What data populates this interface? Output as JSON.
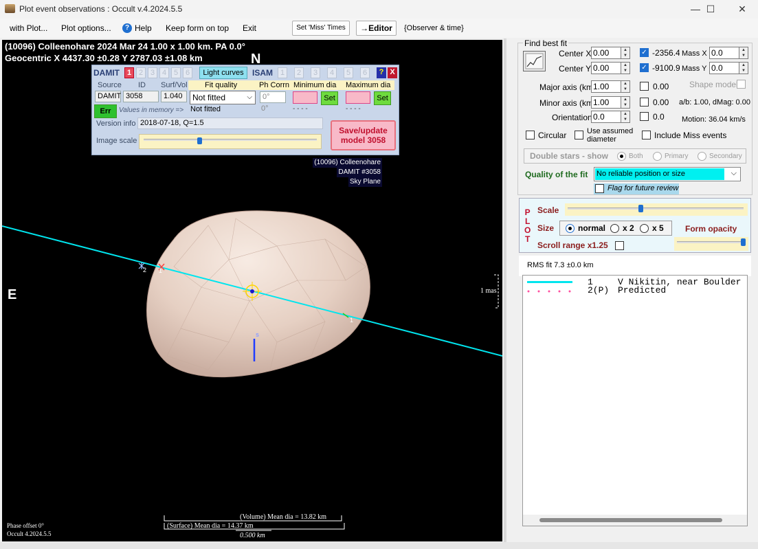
{
  "window": {
    "title": "Plot event observations : Occult v.4.2024.5.5",
    "min": "—",
    "max": "☐",
    "close": "✕"
  },
  "menu": {
    "with_plot": "with Plot...",
    "plot_options": "Plot options...",
    "help": "Help",
    "keep_on_top": "Keep form on top",
    "exit": "Exit",
    "set_miss": "Set 'Miss' Times",
    "editor": "→Editor",
    "observer_time": "{Observer & time}"
  },
  "plot": {
    "header1": "(10096) Colleenohare  2024 Mar 24   1.00 x 1.00 km.  PA 0.0°",
    "header2": "Geocentric  X 4437.30 ±0.28  Y 2787.03 ±1.08 km",
    "north": "N",
    "east": "E",
    "south": "s",
    "chord_labels": [
      "2",
      "1",
      "1"
    ],
    "model_label": [
      "(10096) Colleenohare",
      "DAMIT #3058",
      "Sky Plane"
    ],
    "scale_mas": "1 mas",
    "volume_dia": "(Volume) Mean dia = 13.82 km",
    "surface_dia": "(Surface) Mean dia = 14.37 km",
    "scale_km": "0.500 km",
    "phase_offset": "Phase offset 0°",
    "version": "Occult 4.2024.5.5"
  },
  "damit": {
    "damit_label": "DAMIT",
    "nums": [
      "1",
      "2",
      "3",
      "4",
      "5",
      "6"
    ],
    "light_curves": "Light curves",
    "isam_label": "ISAM",
    "isam_nums": [
      "1",
      "2",
      "3",
      "4",
      "5",
      "6"
    ],
    "help": "?",
    "close": "X",
    "source_h": "Source",
    "id_h": "ID",
    "surfvol_h": "Surf/Vol",
    "fit_quality_h": "Fit quality",
    "ph_corrn_h": "Ph Corrn",
    "min_dia_h": "Minimum dia",
    "max_dia_h": "Maximum dia",
    "source": "DAMIT",
    "id": "3058",
    "surfvol": "1.040",
    "fit_quality": "Not fitted",
    "ph_corrn": "0°",
    "set": "Set",
    "err": "Err",
    "values_in_memory": "Values in memory =>",
    "mem_fit": "Not fitted",
    "mem_ph": "0°",
    "mem_min": "- - - -",
    "mem_max": "- - - -",
    "version_info_label": "Version info",
    "version_info": "2018-07-18, Q=1.5",
    "image_scale_label": "Image scale",
    "save_update": "Save/update model 3058"
  },
  "right": {
    "find_best_fit": "Find best fit",
    "center_x_label": "Center X",
    "center_x": "0.00",
    "center_y_label": "Center Y",
    "center_y": "0.00",
    "res_x": "-2356.44",
    "res_y": "-9100.93",
    "mass_x_label": "Mass X",
    "mass_x": "0.0",
    "mass_y_label": "Mass Y",
    "mass_y": "0.0",
    "major_label": "Major axis (km)",
    "major": "1.00",
    "major_res": "0.00",
    "minor_label": "Minor axis (km)",
    "minor": "1.00",
    "minor_res": "0.00",
    "orient_label": "Orientation",
    "orient": "0.0",
    "orient_res": "0.0",
    "shape_model": "Shape model",
    "ab_dmag": "a/b: 1.00, dMag: 0.00",
    "motion": "Motion: 36.04 km/s",
    "circular": "Circular",
    "use_assumed": "Use assumed diameter",
    "include_miss": "Include Miss events",
    "double_stars": "Double stars - show",
    "both": "Both",
    "primary": "Primary",
    "secondary": "Secondary",
    "quality_label": "Quality of the fit",
    "quality_value": "No reliable position or size",
    "flag_review": "Flag for future review",
    "plot_letters": [
      "P",
      "L",
      "O",
      "T"
    ],
    "scale_label": "Scale",
    "size_label": "Size",
    "size_normal": "normal",
    "size_x2": "x 2",
    "size_x5": "x 5",
    "form_opacity": "Form opacity",
    "scroll_range": "Scroll range x1.25",
    "rms_fit": "RMS fit 7.3 ±0.0 km",
    "legend": [
      {
        "num": "1",
        "text": "V Nikitin, near Boulder"
      },
      {
        "num": "2(P)",
        "text": "Predicted"
      }
    ]
  },
  "colors": {
    "observed_chord": "#00e5ee",
    "predicted": "#ff4fa0",
    "asteroid": "#e8d3c6",
    "accent": "#1f6fd0"
  }
}
